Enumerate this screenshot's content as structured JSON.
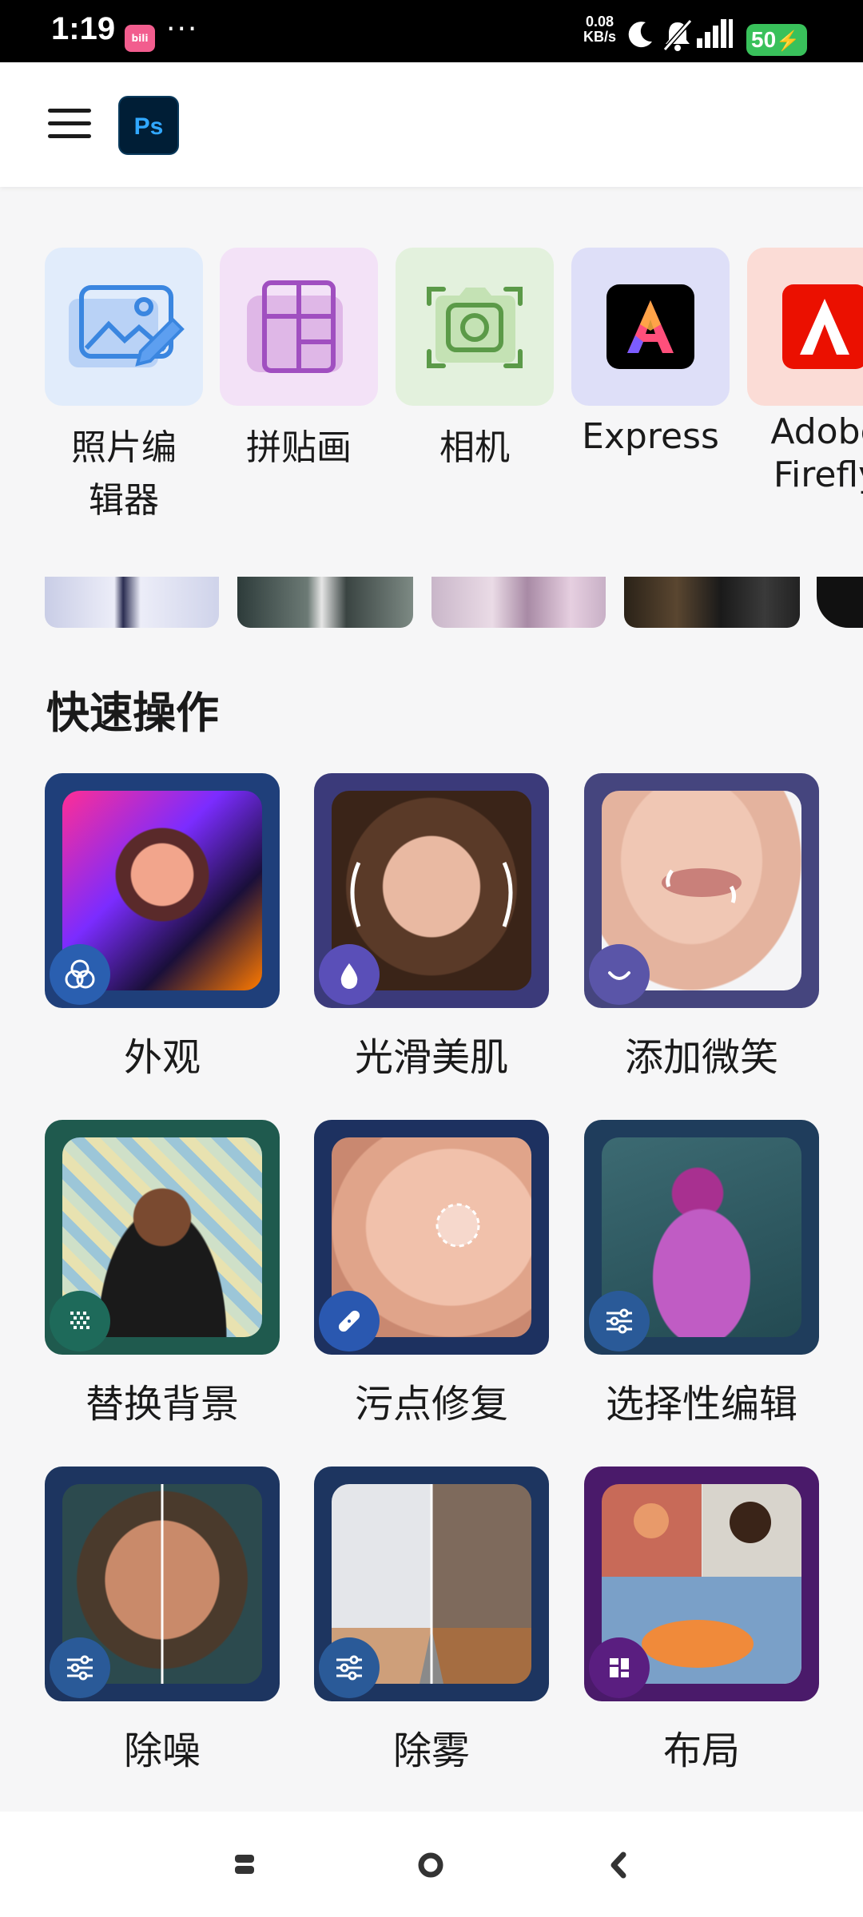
{
  "status_bar": {
    "time": "1:19",
    "app_badge": "bilibili",
    "more": "···",
    "net_speed_value": "0.08",
    "net_speed_unit": "KB/s",
    "battery": "50"
  },
  "app_bar": {
    "menu_icon": "hamburger-icon",
    "logo_text": "Ps"
  },
  "apps": [
    {
      "label": "照片编\n辑器",
      "icon": "photo-editor-icon",
      "bg": "#e1ecfb"
    },
    {
      "label": "拼贴画",
      "icon": "collage-icon",
      "bg": "#f3e2f7"
    },
    {
      "label": "相机",
      "icon": "camera-icon",
      "bg": "#e3f1dd"
    },
    {
      "label": "Express",
      "icon": "adobe-express-icon",
      "bg": "#dedff8"
    },
    {
      "label": "Adobe\nFirefly",
      "icon": "adobe-firefly-icon",
      "bg": "#fbdcd6"
    }
  ],
  "section": {
    "quick_actions_title": "快速操作"
  },
  "quick_actions": [
    {
      "label": "外观",
      "icon": "looks-icon"
    },
    {
      "label": "光滑美肌",
      "icon": "water-drop-icon"
    },
    {
      "label": "添加微笑",
      "icon": "smile-icon"
    },
    {
      "label": "替换背景",
      "icon": "background-pattern-icon"
    },
    {
      "label": "污点修复",
      "icon": "bandage-icon"
    },
    {
      "label": "选择性编辑",
      "icon": "sliders-icon"
    },
    {
      "label": "除噪",
      "icon": "sliders-icon"
    },
    {
      "label": "除雾",
      "icon": "sliders-icon"
    },
    {
      "label": "布局",
      "icon": "layout-grid-icon"
    }
  ],
  "nav": {
    "recents": "recents-icon",
    "home": "home-icon",
    "back": "back-icon"
  }
}
